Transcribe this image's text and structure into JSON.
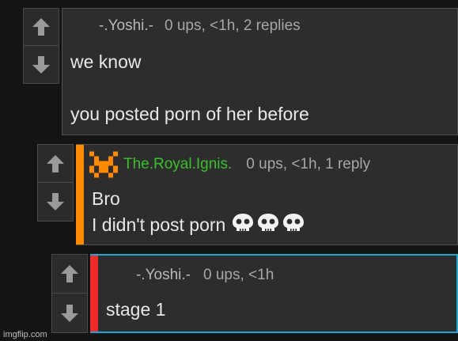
{
  "comments": [
    {
      "username": "-.Yoshi.-",
      "stats": "0 ups, <1h, 2 replies",
      "lines": [
        "we know",
        "",
        "you posted porn of her before"
      ]
    },
    {
      "username": "The.Royal.Ignis.",
      "stats": "0 ups, <1h, 1 reply",
      "lines": [
        "Bro",
        "I didn't post porn"
      ],
      "emoji": "💀💀💀",
      "accent_color": "#ff8a00",
      "username_color": "#39c12b"
    },
    {
      "username": "-.Yoshi.-",
      "stats": "0 ups, <1h",
      "lines": [
        "stage 1"
      ],
      "accent_color": "#ee2b2b",
      "highlight_border": "#1aa7d6"
    }
  ],
  "watermark": "imgflip.com",
  "icons": {
    "upvote": "arrow-up-icon",
    "downvote": "arrow-down-icon",
    "skull": "skull-icon",
    "avatar": "pixel-avatar-icon"
  }
}
